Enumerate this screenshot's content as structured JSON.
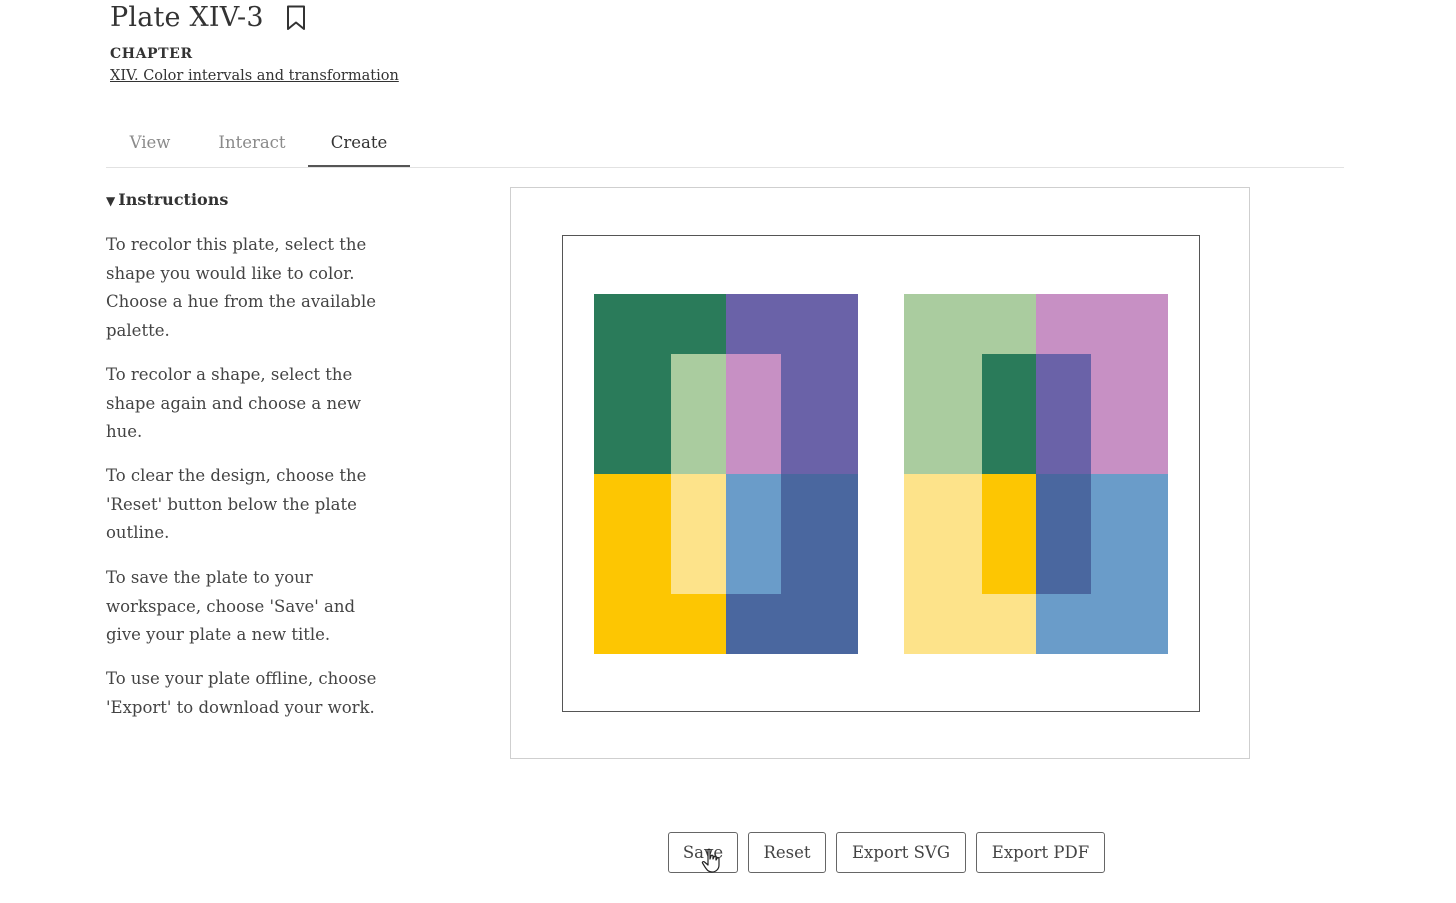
{
  "header": {
    "title": "Plate XIV-3",
    "chapter_label": "CHAPTER",
    "chapter_link": "XIV. Color intervals and transformation"
  },
  "tabs": [
    {
      "label": "View",
      "active": false
    },
    {
      "label": "Interact",
      "active": false
    },
    {
      "label": "Create",
      "active": true
    }
  ],
  "instructions": {
    "heading": "Instructions",
    "paragraphs": [
      "To recolor this plate, select the shape you would like to color. Choose a hue from the available palette.",
      "To recolor a shape, select the shape again and choose a new hue.",
      "To clear the design, choose the 'Reset' button below the plate outline.",
      "To save the plate to your workspace, choose 'Save' and give your plate a new title.",
      "To use your plate offline, choose 'Export' to download your work."
    ]
  },
  "colors": {
    "dark_green": "#2a7b5a",
    "light_green": "#aacc9f",
    "purple": "#6a62a8",
    "pink": "#c790c4",
    "yellow": "#fdc602",
    "light_yellow": "#fde38a",
    "light_blue": "#6a9cc9",
    "dark_blue": "#4a679f"
  },
  "buttons": {
    "save": "Save",
    "reset": "Reset",
    "export_svg": "Export SVG",
    "export_pdf": "Export PDF"
  },
  "icons": {
    "bookmark": "bookmark-icon",
    "cursor": "hand-pointer-icon"
  }
}
